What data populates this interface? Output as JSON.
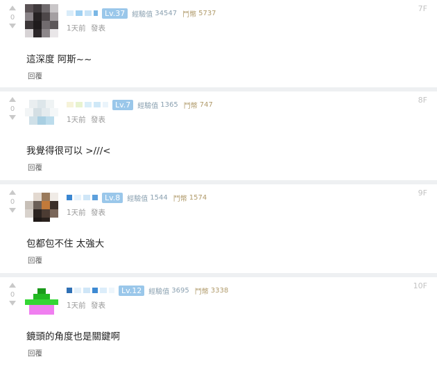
{
  "comments": [
    {
      "votes": "0",
      "level": "Lv.37",
      "exp_label": "經驗值",
      "exp_value": "34547",
      "gold_label": "鬥幣",
      "gold_value": "5737",
      "time": "1天前",
      "action": "發表",
      "floor": "7F",
      "text": "這深度 阿斯~~",
      "reply_label": "回覆"
    },
    {
      "votes": "0",
      "level": "Lv.7",
      "exp_label": "經驗值",
      "exp_value": "1365",
      "gold_label": "鬥幣",
      "gold_value": "747",
      "time": "1天前",
      "action": "發表",
      "floor": "8F",
      "text": "我覺得很可以 >///<",
      "reply_label": "回覆"
    },
    {
      "votes": "0",
      "level": "Lv.8",
      "exp_label": "經驗值",
      "exp_value": "1544",
      "gold_label": "鬥幣",
      "gold_value": "1574",
      "time": "1天前",
      "action": "發表",
      "floor": "9F",
      "text": "包都包不住 太強大",
      "reply_label": "回覆"
    },
    {
      "votes": "0",
      "level": "Lv.12",
      "exp_label": "經驗值",
      "exp_value": "3695",
      "gold_label": "鬥幣",
      "gold_value": "3338",
      "time": "1天前",
      "action": "發表",
      "floor": "10F",
      "text": "鏡頭的角度也是關鍵啊",
      "reply_label": "回覆"
    }
  ],
  "colors": {
    "level_badge": "#9ac7ea",
    "separator": "#eef0f2",
    "exp_text": "#8aa0b0",
    "gold_text": "#b09a6a"
  },
  "icons": [
    "upvote-arrow-icon",
    "downvote-arrow-icon",
    "avatar-pixelated"
  ]
}
